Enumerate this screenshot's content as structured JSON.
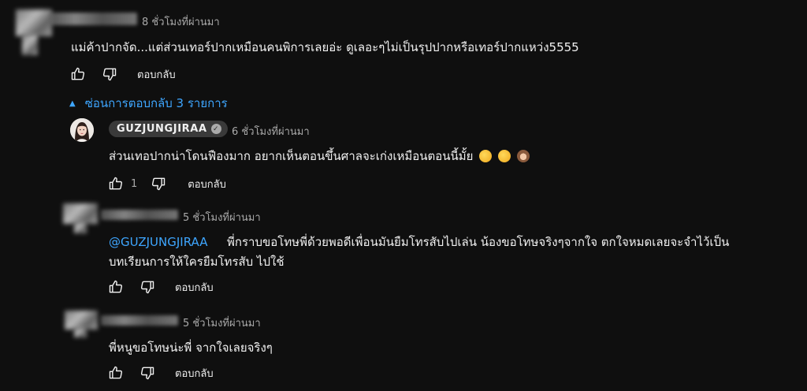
{
  "comments": [
    {
      "time": "8 ชั่วโมงที่ผ่านมา",
      "text": "แม่ค้าปากจัด...แต่ส่วนเทอร์ปากเหมือนคนพิการเลยอ่ะ ดูเลอะๆไม่เป็นรุปปากหรือเทอร์ปากแหว่ง5555",
      "reply_label": "ตอบกลับ",
      "hide_replies_label": "ซ่อนการตอบกลับ 3 รายการ"
    }
  ],
  "replies": [
    {
      "author": "GUZJUNGJIRAA",
      "time": "6 ชั่วโมงที่ผ่านมา",
      "text": "ส่วนเทอปากน่าโดนฟืองมาก อยากเห็นตอนขึ้นศาลจะเก่งเหมือนตอนนี้มั้ย",
      "emojis": [
        "rolling-laughing-emoji",
        "rolling-laughing-emoji",
        "see-no-evil-monkey-emoji"
      ],
      "like_count": "1",
      "reply_label": "ตอบกลับ"
    },
    {
      "time": "5 ชั่วโมงที่ผ่านมา",
      "mention": "@GUZJUNGJIRAA",
      "text_line1": "พี่กราบขอโทษพี่ด้วยพอดีเพื่อนมันยืมโทรสับไปเล่น น้องขอโทษจริงๆจากใจ ตกใจหมดเลยจะจำไว้เป็น",
      "text_line2": "บทเรียนการให้ใครยืมโทรสับ ไปใช้",
      "reply_label": "ตอบกลับ"
    },
    {
      "time": "5 ชั่วโมงที่ผ่านมา",
      "text": "พี่หนูขอโทษน่ะพี่ จากใจเลยจริงๆ",
      "reply_label": "ตอบกลับ"
    }
  ],
  "colors": {
    "background": "#0f0f0f",
    "link": "#3ea6ff",
    "muted": "#aaaaaa",
    "text": "#f1f1f1"
  }
}
